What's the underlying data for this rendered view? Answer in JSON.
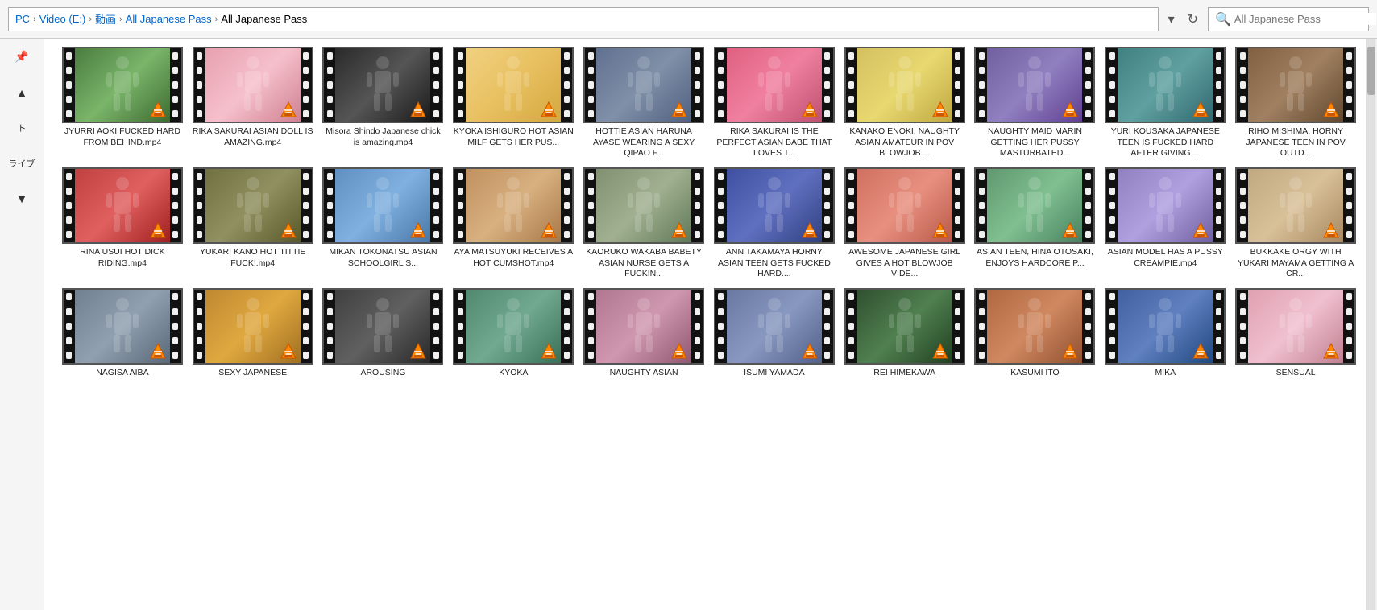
{
  "addressBar": {
    "path": [
      "PC",
      "Video (E:)",
      "動画",
      "All Japanese Pass",
      "All Japanese Pass"
    ],
    "searchPlaceholder": "All Japanese Pass"
  },
  "sidebar": {
    "items": [
      {
        "label": "ライブ"
      },
      {
        "label": "ト"
      }
    ]
  },
  "videos": [
    {
      "id": 1,
      "label": "JYURRI AOKI FUCKED HARD FROM BEHIND.mp4",
      "bg": "bg-green"
    },
    {
      "id": 2,
      "label": "RIKA SAKURAI ASIAN DOLL IS AMAZING.mp4",
      "bg": "bg-pink"
    },
    {
      "id": 3,
      "label": "Misora Shindo Japanese chick is amazing.mp4",
      "bg": "bg-dark"
    },
    {
      "id": 4,
      "label": "KYOKA ISHIGURO HOT ASIAN MILF GETS HER PUS...",
      "bg": "bg-floral"
    },
    {
      "id": 5,
      "label": "HOTTIE ASIAN HARUNA AYASE WEARING A SEXY QIPAO F...",
      "bg": "bg-blue-gray"
    },
    {
      "id": 6,
      "label": "RIKA SAKURAI IS THE PERFECT ASIAN BABE THAT LOVES T...",
      "bg": "bg-rose"
    },
    {
      "id": 7,
      "label": "KANAKO ENOKI, NAUGHTY ASIAN AMATEUR IN POV BLOWJOB....",
      "bg": "bg-yellow"
    },
    {
      "id": 8,
      "label": "NAUGHTY MAID MARIN GETTING HER PUSSY MASTURBATED...",
      "bg": "bg-purple"
    },
    {
      "id": 9,
      "label": "YURI KOUSAKA JAPANESE TEEN IS FUCKED HARD AFTER GIVING ...",
      "bg": "bg-teal"
    },
    {
      "id": 10,
      "label": "RIHO MISHIMA, HORNY JAPANESE TEEN IN POV OUTD...",
      "bg": "bg-brown"
    },
    {
      "id": 11,
      "label": "RINA USUI HOT DICK RIDING.mp4",
      "bg": "bg-red"
    },
    {
      "id": 12,
      "label": "YUKARI KANO HOT TITTIE FUCK!.mp4",
      "bg": "bg-olive"
    },
    {
      "id": 13,
      "label": "MIKAN TOKONATSU ASIAN SCHOOLGIRL S...",
      "bg": "bg-sky"
    },
    {
      "id": 14,
      "label": "AYA MATSUYUKI RECEIVES A HOT CUMSHOT.mp4",
      "bg": "bg-warm"
    },
    {
      "id": 15,
      "label": "KAORUKO WAKABA BABETY ASIAN NURSE GETS A FUCKIN...",
      "bg": "bg-sage"
    },
    {
      "id": 16,
      "label": "ANN TAKAMAYA HORNY ASIAN TEEN GETS FUCKED HARD....",
      "bg": "bg-indigo"
    },
    {
      "id": 17,
      "label": "AWESOME JAPANESE GIRL GIVES A HOT BLOWJOB VIDE...",
      "bg": "bg-coral"
    },
    {
      "id": 18,
      "label": "ASIAN TEEN, HINA OTOSAKI, ENJOYS HARDCORE P...",
      "bg": "bg-mint"
    },
    {
      "id": 19,
      "label": "ASIAN MODEL HAS A PUSSY CREAMPIE.mp4",
      "bg": "bg-lavender"
    },
    {
      "id": 20,
      "label": "BUKKAKE ORGY WITH YUKARI MAYAMA GETTING A CR...",
      "bg": "bg-tan"
    },
    {
      "id": 21,
      "label": "NAGISA AIBA",
      "bg": "bg-slate"
    },
    {
      "id": 22,
      "label": "SEXY JAPANESE",
      "bg": "bg-amber"
    },
    {
      "id": 23,
      "label": "AROUSING",
      "bg": "bg-charcoal"
    },
    {
      "id": 24,
      "label": "KYOKA",
      "bg": "bg-seafoam"
    },
    {
      "id": 25,
      "label": "NAUGHTY ASIAN",
      "bg": "bg-mauve"
    },
    {
      "id": 26,
      "label": "ISUMI YAMADA",
      "bg": "bg-steel"
    },
    {
      "id": 27,
      "label": "REI HIMEKAWA",
      "bg": "bg-forest"
    },
    {
      "id": 28,
      "label": "KASUMI ITO",
      "bg": "bg-copper"
    },
    {
      "id": 29,
      "label": "MIKA",
      "bg": "bg-denim"
    },
    {
      "id": 30,
      "label": "SENSUAL",
      "bg": "bg-blush"
    }
  ]
}
